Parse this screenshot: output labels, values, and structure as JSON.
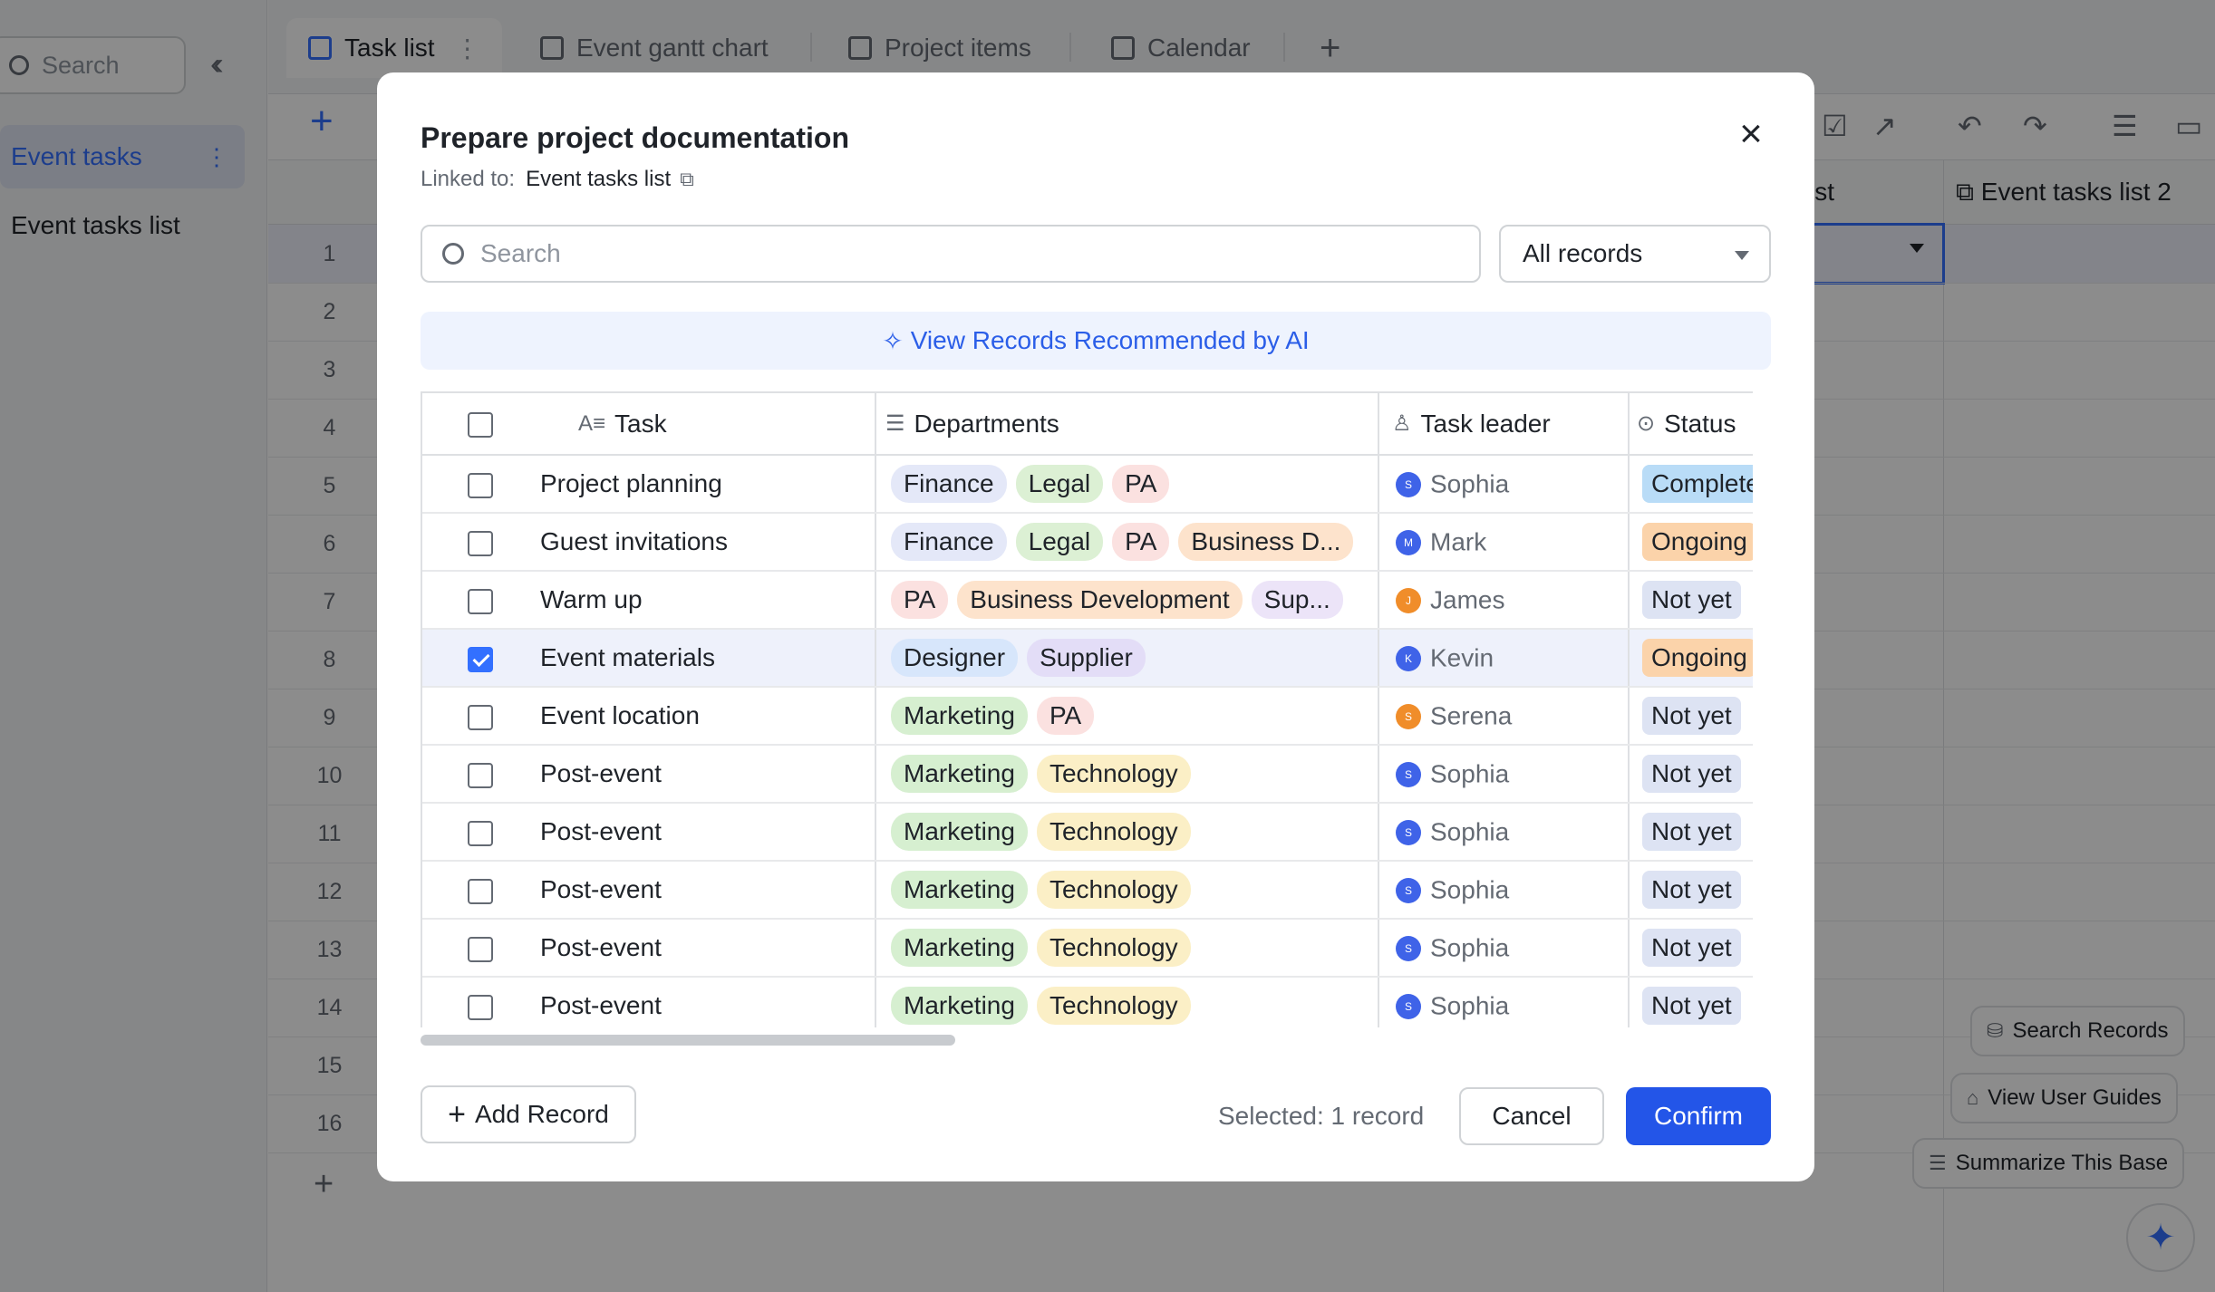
{
  "sidebar": {
    "search_placeholder": "Search",
    "items": [
      {
        "label": "Event tasks",
        "active": true
      },
      {
        "label": "Event tasks list",
        "active": false
      }
    ]
  },
  "tabs": [
    {
      "label": "Task list",
      "icon": "table-icon",
      "active": true
    },
    {
      "label": "Event gantt chart",
      "icon": "gantt-icon"
    },
    {
      "label": "Project items",
      "icon": "grid-icon"
    },
    {
      "label": "Calendar",
      "icon": "calendar-icon"
    }
  ],
  "grid": {
    "row_numbers": [
      "1",
      "2",
      "3",
      "4",
      "5",
      "6",
      "7",
      "8",
      "9",
      "10",
      "11",
      "12",
      "13",
      "14",
      "15",
      "16"
    ],
    "header_partial": "ist",
    "header_col2": "Event tasks list 2"
  },
  "floating": {
    "search_records": "Search Records",
    "view_user_guides": "View User Guides",
    "summarize_base": "Summarize This Base"
  },
  "modal": {
    "title": "Prepare project documentation",
    "linked_prefix": "Linked to:",
    "linked_target": "Event tasks list",
    "search_placeholder": "Search",
    "filter_value": "All records",
    "ai_link": "View Records Recommended by AI",
    "columns": {
      "task": "Task",
      "departments": "Departments",
      "task_leader": "Task leader",
      "status": "Status"
    },
    "rows": [
      {
        "task": "Project planning",
        "departments": [
          "Finance",
          "Legal",
          "PA"
        ],
        "leader": "Sophia",
        "leader_initial": "S",
        "status": "Complete",
        "checked": false
      },
      {
        "task": "Guest invitations",
        "departments": [
          "Finance",
          "Legal",
          "PA",
          "Business D..."
        ],
        "leader": "Mark",
        "leader_initial": "M",
        "status": "Ongoing",
        "checked": false
      },
      {
        "task": "Warm up",
        "departments": [
          "PA",
          "Business Development",
          "Sup..."
        ],
        "leader": "James",
        "leader_initial": "J",
        "status": "Not yet",
        "checked": false
      },
      {
        "task": "Event materials",
        "departments": [
          "Designer",
          "Supplier"
        ],
        "leader": "Kevin",
        "leader_initial": "K",
        "status": "Ongoing",
        "checked": true
      },
      {
        "task": "Event location",
        "departments": [
          "Marketing",
          "PA"
        ],
        "leader": "Serena",
        "leader_initial": "S",
        "status": "Not yet",
        "checked": false
      },
      {
        "task": "Post-event",
        "departments": [
          "Marketing",
          "Technology"
        ],
        "leader": "Sophia",
        "leader_initial": "S",
        "status": "Not yet",
        "checked": false
      },
      {
        "task": "Post-event",
        "departments": [
          "Marketing",
          "Technology"
        ],
        "leader": "Sophia",
        "leader_initial": "S",
        "status": "Not yet",
        "checked": false
      },
      {
        "task": "Post-event",
        "departments": [
          "Marketing",
          "Technology"
        ],
        "leader": "Sophia",
        "leader_initial": "S",
        "status": "Not yet",
        "checked": false
      },
      {
        "task": "Post-event",
        "departments": [
          "Marketing",
          "Technology"
        ],
        "leader": "Sophia",
        "leader_initial": "S",
        "status": "Not yet",
        "checked": false
      },
      {
        "task": "Post-event",
        "departments": [
          "Marketing",
          "Technology"
        ],
        "leader": "Sophia",
        "leader_initial": "S",
        "status": "Not yet",
        "checked": false
      }
    ],
    "add_record": "Add Record",
    "selected_text": "Selected: 1 record",
    "cancel": "Cancel",
    "confirm": "Confirm"
  },
  "colors": {
    "accent": "#3370ff",
    "confirm_button": "#2355e8",
    "overlay": "rgba(0,0,0,0.45)"
  }
}
